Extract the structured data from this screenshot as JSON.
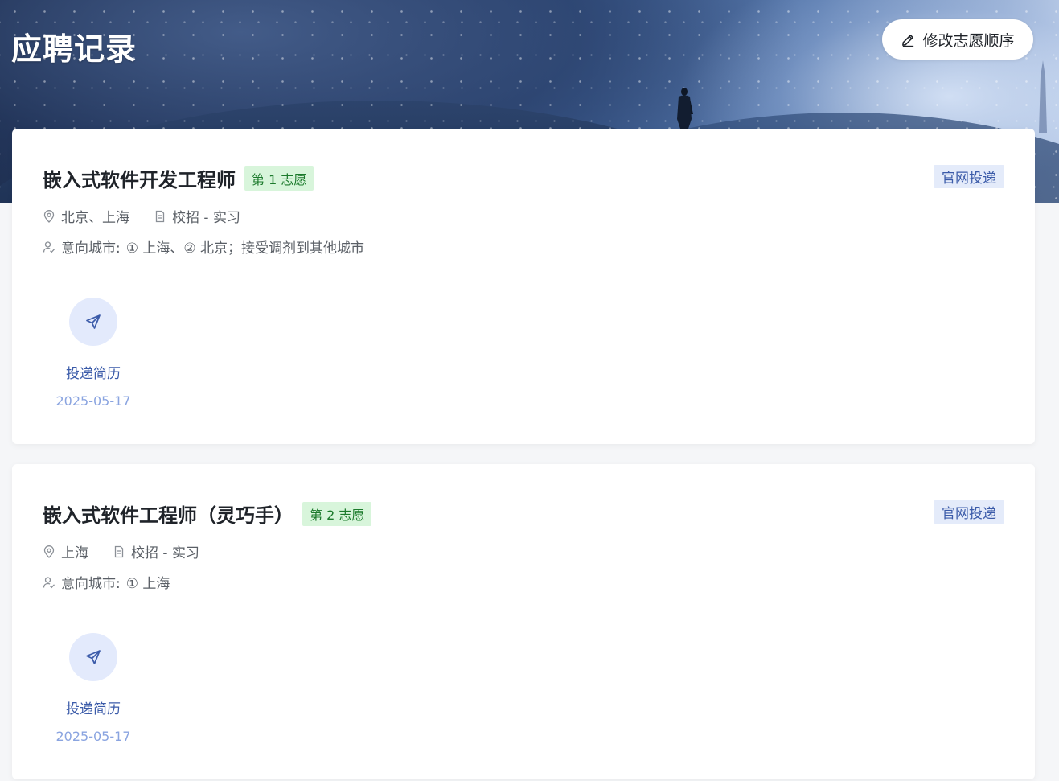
{
  "header": {
    "title": "应聘记录",
    "edit_button": {
      "label": "修改志愿顺序",
      "icon": "pencil-icon"
    }
  },
  "colors": {
    "accent_blue": "#3b5ba9",
    "badge_green_bg": "#d8f5db",
    "badge_green_text": "#1c7a2c",
    "badge_blue_bg": "#e4ebfa",
    "date_blue": "#8aa4e0"
  },
  "applications": [
    {
      "title": "嵌入式软件开发工程师",
      "preference": "第 1 志愿",
      "source": "官网投递",
      "location": "北京、上海",
      "job_type": "校招 - 实习",
      "intent_label": "意向城市:",
      "intent_value": "① 上海、② 北京；接受调剂到其他城市",
      "step": {
        "label": "投递简历",
        "date": "2025-05-17",
        "icon": "paper-plane-icon"
      }
    },
    {
      "title": "嵌入式软件工程师（灵巧手）",
      "preference": "第 2 志愿",
      "source": "官网投递",
      "location": "上海",
      "job_type": "校招 - 实习",
      "intent_label": "意向城市:",
      "intent_value": "① 上海",
      "step": {
        "label": "投递简历",
        "date": "2025-05-17",
        "icon": "paper-plane-icon"
      }
    }
  ]
}
